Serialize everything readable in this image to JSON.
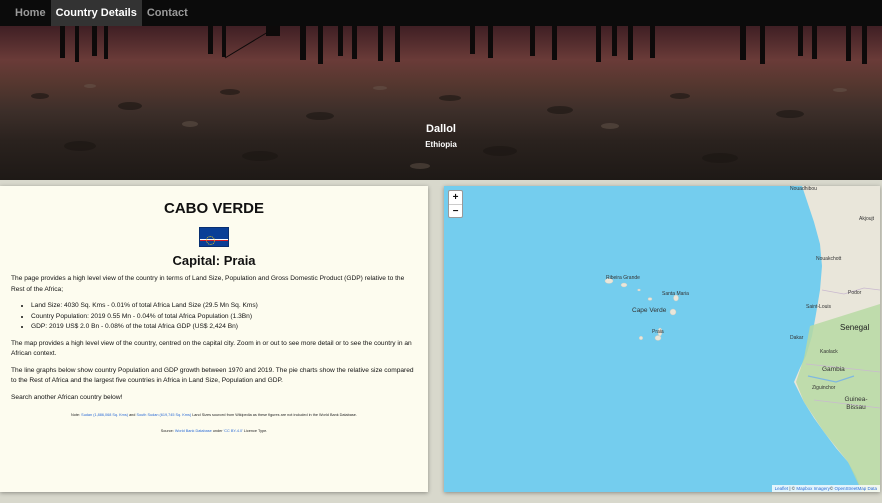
{
  "nav": [
    {
      "label": "Home",
      "active": false
    },
    {
      "label": "Country Details",
      "active": true
    },
    {
      "label": "Contact",
      "active": false
    }
  ],
  "hero": {
    "title": "Dallol",
    "subtitle": "Ethiopia"
  },
  "country": {
    "name": "CABO VERDE",
    "capital": "Capital: Praia",
    "intro": "The page provides a high level view of the country in terms of Land Size, Population and Gross Domestic Product (GDP) relative to the Rest of the Africa;",
    "facts": [
      "Land Size: 4030 Sq. Kms - 0.01% of total Africa Land Size (29.5 Mn Sq. Kms)",
      "Country Population: 2019 0.55 Mn - 0.04% of total Africa Population (1.3Bn)",
      "GDP: 2019 US$ 2.0 Bn - 0.08% of the total Africa GDP (US$ 2,424 Bn)"
    ],
    "map_text": "The map provides a high level view of the country, centred on the capital city. Zoom in or out to see more detail or to see the country in an African context.",
    "graphs_text": "The line graphs below show country Population and GDP growth between 1970 and 2019. The pie charts show the relative size compared to the Rest of Africa and the largest five countries in Africa in Land Size, Population and GDP.",
    "search_text": "Search another African country below!",
    "note_prefix": "Note: ",
    "note_link1": "Sudan (1,886,068 Sq. Kms)",
    "note_and": " and ",
    "note_link2": "South Sudan (619,745 Sq. Kms)",
    "note_suffix": " Land Sizes sourced from Wikipedia as these figures are not included in the World Bank Database.",
    "source_prefix": "Source: ",
    "source_link1": "World Bank Database",
    "source_mid": " under ",
    "source_link2": "'CC BY-4.0'",
    "source_suffix": " Licence Type."
  },
  "map": {
    "zoom_in": "+",
    "zoom_out": "−",
    "labels": {
      "nouadhibou": "Nouadhibou",
      "akjoujt": "Akjoujt",
      "nouakchott": "Nouakchott",
      "saint_louis": "Saint-Louis",
      "podor": "Podor",
      "senegal": "Senegal",
      "dakar": "Dakar",
      "kaolack": "Kaolack",
      "gambia": "Gambia",
      "ziguinchor": "Ziguinchor",
      "guinea_bissau": "Guinea-Bissau",
      "ribeira_grande": "Ribeira Grande",
      "santa_maria": "Santa Maria",
      "cape_verde": "Cape Verde",
      "praia": "Praia"
    },
    "attribution": {
      "leaflet": "Leaflet",
      "sep": " | © ",
      "mapbox": "Mapbox Imagery",
      "copy": "© ",
      "osm": "OpenStreetMap Data"
    },
    "colors": {
      "sea": "#74cdee",
      "land": "#e9e6da",
      "green": "#b7d9a3"
    }
  }
}
